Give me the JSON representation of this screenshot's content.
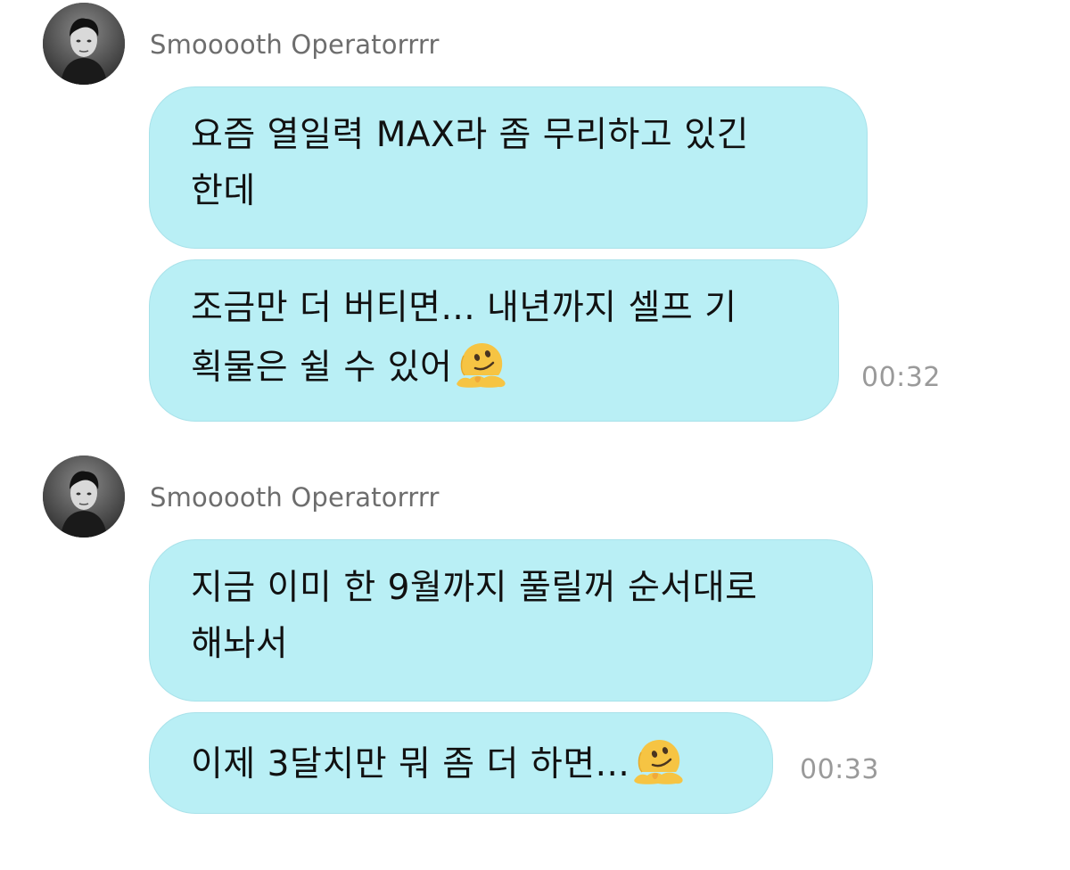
{
  "chat": {
    "groups": [
      {
        "sender": "Smooooth Operatorrrr",
        "messages": [
          {
            "lines": [
              "요즘 열일력 MAX라 좀 무리하고 있긴",
              "한데"
            ]
          },
          {
            "lines": [
              "조금만 더 버티면... 내년까지 셀프 기",
              "획물은 쉴 수 있어"
            ],
            "emoji": "melting-face-emoji",
            "time": "00:32"
          }
        ]
      },
      {
        "sender": "Smooooth Operatorrrr",
        "messages": [
          {
            "lines": [
              "지금 이미 한 9월까지 풀릴꺼 순서대로",
              "해놔서"
            ]
          },
          {
            "lines": [
              "이제 3달치만 뭐 좀 더 하면..."
            ],
            "emoji": "melting-face-emoji",
            "time": "00:33"
          }
        ]
      }
    ]
  },
  "colors": {
    "bubble": "#b9eff5",
    "bubble_border": "#a9e2ea",
    "sender_name": "#6d6d6d",
    "timestamp": "#9a9a9a"
  }
}
